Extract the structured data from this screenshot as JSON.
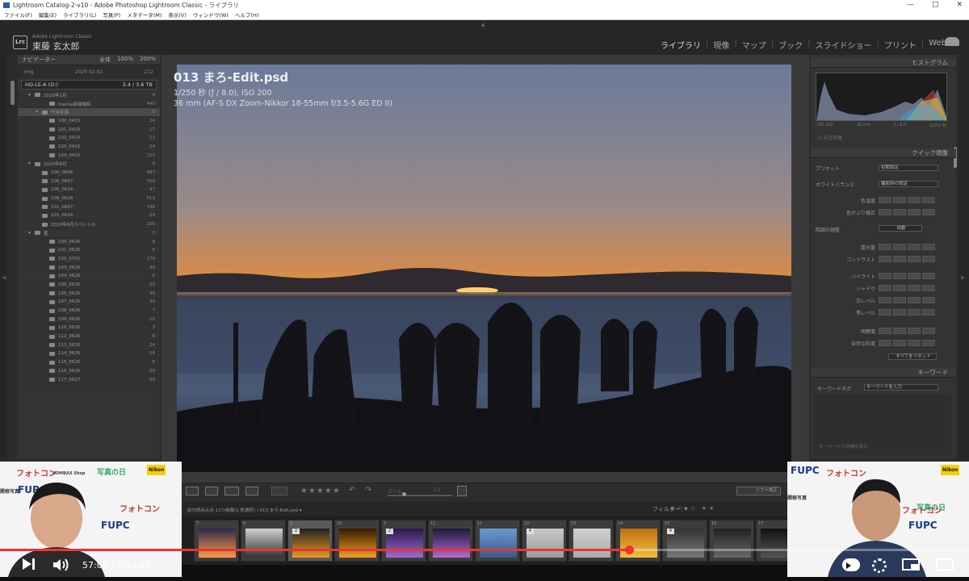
{
  "window": {
    "title": "Lightroom Catalog-2-v10 - Adobe Photoshop Lightroom Classic - ライブラリ",
    "controls": [
      "—",
      "□",
      "✕"
    ]
  },
  "menubar": [
    "ファイル(F)",
    "編集(E)",
    "ライブラリ(L)",
    "写真(P)",
    "メタデータ(M)",
    "表示(V)",
    "ウィンドウ(W)",
    "ヘルプ(H)"
  ],
  "identity": {
    "logo": "Lrc",
    "subtitle": "Adobe Lightroom Classic",
    "name": "東藤 玄太郎"
  },
  "modules": [
    "ライブラリ",
    "現像",
    "マップ",
    "ブック",
    "スライドショー",
    "プリント",
    "Web"
  ],
  "navigator": {
    "title": "ナビゲーター",
    "options": [
      "全体",
      "100%",
      "200%"
    ],
    "thumb_left": "Img",
    "thumb_date": "2020 02 02",
    "thumb_count": "212"
  },
  "volume": {
    "label": "HD-LE-A (D:)",
    "info": "3.4 / 3.6 TB"
  },
  "folders": [
    {
      "name": "2020年1月",
      "count": "0",
      "indent": 1,
      "kind": "dir"
    },
    {
      "name": "manila新緑撮影",
      "count": "440",
      "indent": 3,
      "kind": "file"
    },
    {
      "name": "円寺征服",
      "count": "0",
      "indent": 2,
      "kind": "dir"
    },
    {
      "name": "100_0415",
      "count": "24",
      "indent": 3,
      "kind": "file"
    },
    {
      "name": "101_0415",
      "count": "17",
      "indent": 3,
      "kind": "file"
    },
    {
      "name": "102_0415",
      "count": "12",
      "indent": 3,
      "kind": "file"
    },
    {
      "name": "103_0415",
      "count": "24",
      "indent": 3,
      "kind": "file"
    },
    {
      "name": "104_0415",
      "count": "111",
      "indent": 3,
      "kind": "file"
    },
    {
      "name": "2020年6月",
      "count": "0",
      "indent": 1,
      "kind": "dir"
    },
    {
      "name": "100_0606",
      "count": "487",
      "indent": 2,
      "kind": "file"
    },
    {
      "name": "100_0607",
      "count": "760",
      "indent": 2,
      "kind": "file"
    },
    {
      "name": "100_0624",
      "count": "47",
      "indent": 2,
      "kind": "file"
    },
    {
      "name": "100_0628",
      "count": "511",
      "indent": 2,
      "kind": "file"
    },
    {
      "name": "101_0607",
      "count": "796",
      "indent": 2,
      "kind": "file"
    },
    {
      "name": "101_0624",
      "count": "29",
      "indent": 2,
      "kind": "file"
    },
    {
      "name": "2020年6月スペシャル",
      "count": "105",
      "indent": 2,
      "kind": "file"
    },
    {
      "name": "夏",
      "count": "0",
      "indent": 1,
      "kind": "dir"
    },
    {
      "name": "100_0626",
      "count": "8",
      "indent": 3,
      "kind": "file"
    },
    {
      "name": "101_0626",
      "count": "5",
      "indent": 3,
      "kind": "file"
    },
    {
      "name": "102_0702",
      "count": "170",
      "indent": 3,
      "kind": "file"
    },
    {
      "name": "103_0626",
      "count": "40",
      "indent": 3,
      "kind": "file"
    },
    {
      "name": "104_0626",
      "count": "6",
      "indent": 3,
      "kind": "file"
    },
    {
      "name": "105_0626",
      "count": "20",
      "indent": 3,
      "kind": "file"
    },
    {
      "name": "106_0626",
      "count": "38",
      "indent": 3,
      "kind": "file"
    },
    {
      "name": "107_0626",
      "count": "34",
      "indent": 3,
      "kind": "file"
    },
    {
      "name": "108_0626",
      "count": "7",
      "indent": 3,
      "kind": "file"
    },
    {
      "name": "109_0626",
      "count": "10",
      "indent": 3,
      "kind": "file"
    },
    {
      "name": "110_0626",
      "count": "3",
      "indent": 3,
      "kind": "file"
    },
    {
      "name": "112_0626",
      "count": "8",
      "indent": 3,
      "kind": "file"
    },
    {
      "name": "113_0626",
      "count": "24",
      "indent": 3,
      "kind": "file"
    },
    {
      "name": "114_0626",
      "count": "14",
      "indent": 3,
      "kind": "file"
    },
    {
      "name": "115_0626",
      "count": "6",
      "indent": 3,
      "kind": "file"
    },
    {
      "name": "116_0626",
      "count": "20",
      "indent": 3,
      "kind": "file"
    },
    {
      "name": "117_0627",
      "count": "54",
      "indent": 3,
      "kind": "file"
    }
  ],
  "photo": {
    "title": "013  まろ-Edit.psd",
    "exposure": "1/250 秒 (ƒ / 8.0), ISO 200",
    "lens": "36 mm (AF-S DX Zoom-Nikkor 18-55mm f/3.5-5.6G ED II)"
  },
  "histogram": {
    "title": "ヒストグラム",
    "info": [
      "ISO 200",
      "36 mm",
      "ƒ / 8.0",
      "1/250 秒"
    ],
    "original": "元の写真"
  },
  "quick_develop": {
    "title": "クイック現像",
    "preset_label": "プリセット",
    "preset_value": "初期設定",
    "wb_label": "ホワイトバランス",
    "wb_value": "撮影時の設定",
    "temp_label": "色温度",
    "tint_label": "色かぶり補正",
    "tone_label": "階調の調整",
    "auto_label": "自動",
    "rows": [
      "露光量",
      "コントラスト",
      "ハイライト",
      "シャドウ",
      "白レベル",
      "黒レベル",
      "明瞭度",
      "自然な彩度"
    ],
    "reset_label": "すべてをリセット"
  },
  "keywords": {
    "title": "キーワード",
    "tags_label": "キーワードタグ",
    "tags_value": "キーワードを入力",
    "suggest": "キーワードの候補を表示"
  },
  "toolbar": {
    "zoom_label": "ズーム",
    "zoom_value": "1:1",
    "stars": "★★★★★",
    "compare": "ソフト校正"
  },
  "filmbar": {
    "path": "前の読み込み 117/画像(1 枚選択) / 013 まろ-Edit.psd ▾",
    "filter_label": "フィルター："
  },
  "filmstrip": [
    {
      "num": "7",
      "colors": [
        "#2a2a4a",
        "#ff9a4a"
      ]
    },
    {
      "num": "8",
      "colors": [
        "#cfcfcf",
        "#333"
      ]
    },
    {
      "num": "2",
      "colors": [
        "#222",
        "#e89a20"
      ],
      "badge": "2"
    },
    {
      "num": "10",
      "colors": [
        "#331a00",
        "#f0a020"
      ]
    },
    {
      "num": "2",
      "colors": [
        "#2a1a4a",
        "#9a6ad0"
      ],
      "badge": "2"
    },
    {
      "num": "11",
      "colors": [
        "#1a1a3a",
        "#b06ad0"
      ]
    },
    {
      "num": "11",
      "colors": [
        "#6a9ad0",
        "#3a5a8a"
      ]
    },
    {
      "num": "12",
      "colors": [
        "#c8c8c8",
        "#9a9a9a"
      ],
      "badge": "4"
    },
    {
      "num": "13",
      "colors": [
        "#d0d0d0",
        "#aaa"
      ]
    },
    {
      "num": "14",
      "colors": [
        "#c07010",
        "#f0c040"
      ]
    },
    {
      "num": "15",
      "colors": [
        "#333",
        "#777"
      ],
      "badge": "4"
    },
    {
      "num": "16",
      "colors": [
        "#222",
        "#666"
      ]
    },
    {
      "num": "17",
      "colors": [
        "#111",
        "#555"
      ]
    }
  ],
  "video": {
    "time": "57:00 / 1:53:40",
    "progress": 0.65
  },
  "webcam": {
    "logos": [
      "フォトコン",
      "FUPC",
      "Nikon",
      "写真の日",
      "BOMBAX Shop",
      "関根写真",
      "フォトコン",
      "FUPC"
    ]
  }
}
